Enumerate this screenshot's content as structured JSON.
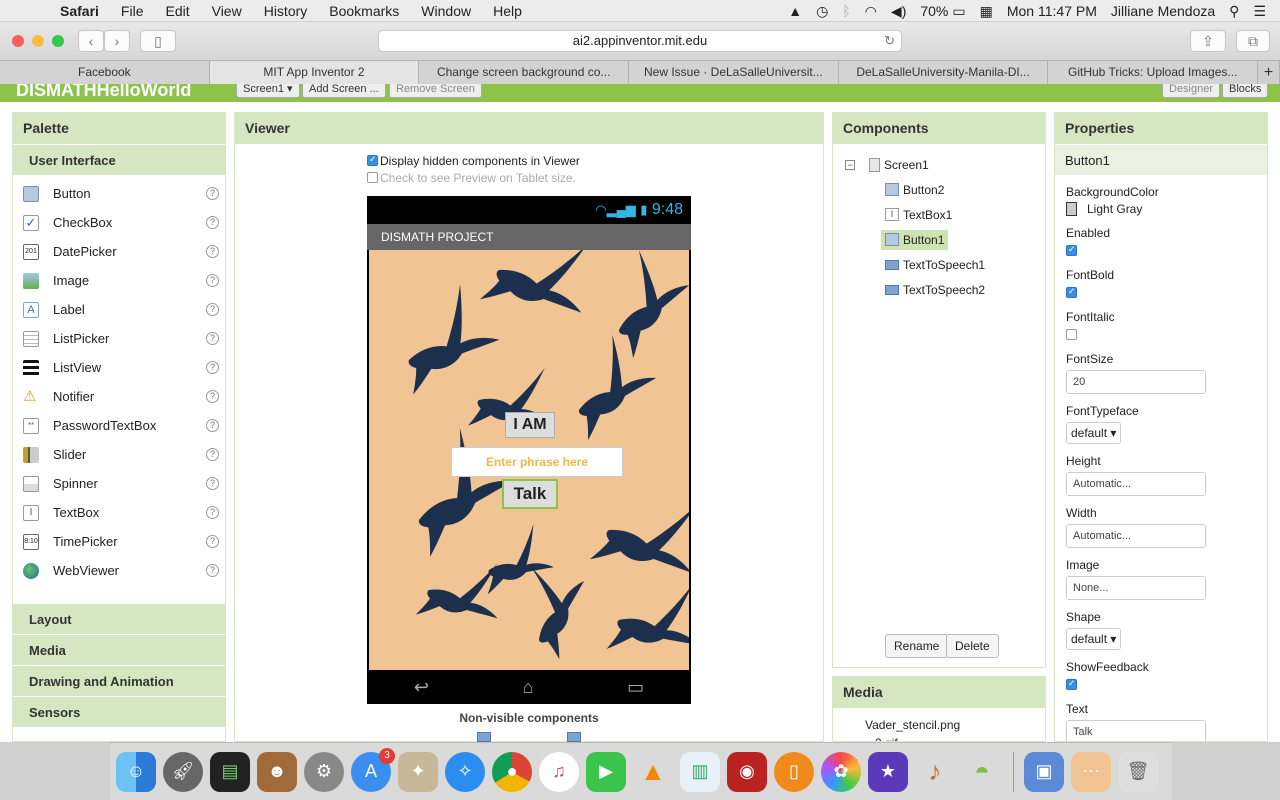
{
  "menubar": {
    "app": "Safari",
    "items": [
      "File",
      "Edit",
      "View",
      "History",
      "Bookmarks",
      "Window",
      "Help"
    ],
    "battery": "70%",
    "clock": "Mon 11:47 PM",
    "user": "Jilliane Mendoza"
  },
  "browser": {
    "url": "ai2.appinventor.mit.edu",
    "tabs": [
      "Facebook",
      "MIT App Inventor 2",
      "Change screen background co...",
      "New Issue · DeLaSalleUniversit...",
      "DeLaSalleUniversity-Manila-DI...",
      "GitHub Tricks: Upload Images..."
    ],
    "new_tab": "+"
  },
  "header": {
    "project": "DISMATHHelloWorld",
    "screen_select": "Screen1 ▾",
    "add_screen": "Add Screen ...",
    "remove_screen": "Remove Screen",
    "designer": "Designer",
    "blocks": "Blocks"
  },
  "palette": {
    "title": "Palette",
    "category": "User Interface",
    "items": [
      "Button",
      "CheckBox",
      "DatePicker",
      "Image",
      "Label",
      "ListPicker",
      "ListView",
      "Notifier",
      "PasswordTextBox",
      "Slider",
      "Spinner",
      "TextBox",
      "TimePicker",
      "WebViewer"
    ],
    "help": "?",
    "categories": [
      "Layout",
      "Media",
      "Drawing and Animation",
      "Sensors"
    ]
  },
  "viewer": {
    "title": "Viewer",
    "display_hidden": "Display hidden components in Viewer",
    "tablet_preview": "Check to see Preview on Tablet size.",
    "time": "9:48",
    "app_title": "DISMATH PROJECT",
    "button2": "I AM",
    "textbox_hint": "Enter phrase here",
    "button1": "Talk",
    "non_visible": "Non-visible components"
  },
  "components": {
    "title": "Components",
    "tree": [
      "Screen1",
      "Button2",
      "TextBox1",
      "Button1",
      "TextToSpeech1",
      "TextToSpeech2"
    ],
    "rename": "Rename",
    "delete": "Delete"
  },
  "media": {
    "title": "Media",
    "files": [
      "Vader_stencil.png",
      "...2.gif"
    ]
  },
  "properties": {
    "title": "Properties",
    "component": "Button1",
    "background_color_label": "BackgroundColor",
    "background_color_value": "Light Gray",
    "enabled_label": "Enabled",
    "enabled": true,
    "fontbold_label": "FontBold",
    "fontbold": true,
    "fontitalic_label": "FontItalic",
    "fontitalic": false,
    "fontsize_label": "FontSize",
    "fontsize_value": "20",
    "fonttypeface_label": "FontTypeface",
    "fonttypeface_value": "default ▾",
    "height_label": "Height",
    "height_value": "Automatic...",
    "width_label": "Width",
    "width_value": "Automatic...",
    "image_label": "Image",
    "image_value": "None...",
    "shape_label": "Shape",
    "shape_value": "default ▾",
    "showfeedback_label": "ShowFeedback",
    "showfeedback": true,
    "text_label": "Text",
    "text_value": "Talk"
  },
  "colors": {
    "accent": "#8dc34a",
    "panel_header": "#d5e7c0",
    "phone_bg": "#f1c593",
    "bird": "#1c2f4d"
  }
}
